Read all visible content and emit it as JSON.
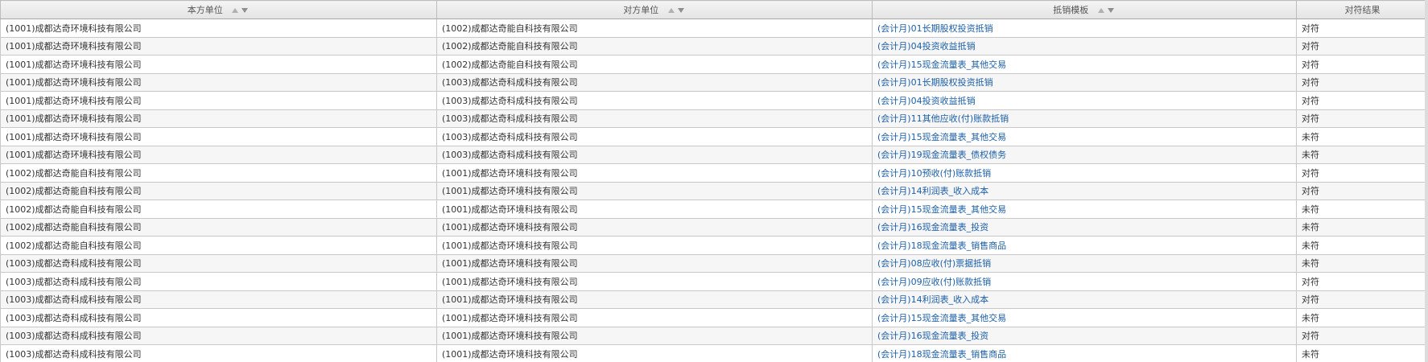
{
  "columns": [
    {
      "label": "本方单位",
      "sortable": true
    },
    {
      "label": "对方单位",
      "sortable": true
    },
    {
      "label": "抵销模板",
      "sortable": true
    },
    {
      "label": "对符结果",
      "sortable": false
    }
  ],
  "colors": {
    "link": "#1c5fa8",
    "header_bg": "#e9e9e9",
    "row_alt_bg": "#f6f6f6",
    "border": "#c8c8c8"
  },
  "rows": [
    {
      "own": "(1001)成都达奇环境科技有限公司",
      "counter": "(1002)成都达奇能自科技有限公司",
      "template": "(会计月)01长期股权投资抵销",
      "result": "对符"
    },
    {
      "own": "(1001)成都达奇环境科技有限公司",
      "counter": "(1002)成都达奇能自科技有限公司",
      "template": "(会计月)04投资收益抵销",
      "result": "对符"
    },
    {
      "own": "(1001)成都达奇环境科技有限公司",
      "counter": "(1002)成都达奇能自科技有限公司",
      "template": "(会计月)15现金流量表_其他交易",
      "result": "对符"
    },
    {
      "own": "(1001)成都达奇环境科技有限公司",
      "counter": "(1003)成都达奇科成科技有限公司",
      "template": "(会计月)01长期股权投资抵销",
      "result": "对符"
    },
    {
      "own": "(1001)成都达奇环境科技有限公司",
      "counter": "(1003)成都达奇科成科技有限公司",
      "template": "(会计月)04投资收益抵销",
      "result": "对符"
    },
    {
      "own": "(1001)成都达奇环境科技有限公司",
      "counter": "(1003)成都达奇科成科技有限公司",
      "template": "(会计月)11其他应收(付)账款抵销",
      "result": "对符"
    },
    {
      "own": "(1001)成都达奇环境科技有限公司",
      "counter": "(1003)成都达奇科成科技有限公司",
      "template": "(会计月)15现金流量表_其他交易",
      "result": "未符"
    },
    {
      "own": "(1001)成都达奇环境科技有限公司",
      "counter": "(1003)成都达奇科成科技有限公司",
      "template": "(会计月)19现金流量表_债权债务",
      "result": "未符"
    },
    {
      "own": "(1002)成都达奇能自科技有限公司",
      "counter": "(1001)成都达奇环境科技有限公司",
      "template": "(会计月)10预收(付)账款抵销",
      "result": "对符"
    },
    {
      "own": "(1002)成都达奇能自科技有限公司",
      "counter": "(1001)成都达奇环境科技有限公司",
      "template": "(会计月)14利润表_收入成本",
      "result": "对符"
    },
    {
      "own": "(1002)成都达奇能自科技有限公司",
      "counter": "(1001)成都达奇环境科技有限公司",
      "template": "(会计月)15现金流量表_其他交易",
      "result": "未符"
    },
    {
      "own": "(1002)成都达奇能自科技有限公司",
      "counter": "(1001)成都达奇环境科技有限公司",
      "template": "(会计月)16现金流量表_投资",
      "result": "未符"
    },
    {
      "own": "(1002)成都达奇能自科技有限公司",
      "counter": "(1001)成都达奇环境科技有限公司",
      "template": "(会计月)18现金流量表_销售商品",
      "result": "未符"
    },
    {
      "own": "(1003)成都达奇科成科技有限公司",
      "counter": "(1001)成都达奇环境科技有限公司",
      "template": "(会计月)08应收(付)票据抵销",
      "result": "未符"
    },
    {
      "own": "(1003)成都达奇科成科技有限公司",
      "counter": "(1001)成都达奇环境科技有限公司",
      "template": "(会计月)09应收(付)账款抵销",
      "result": "对符"
    },
    {
      "own": "(1003)成都达奇科成科技有限公司",
      "counter": "(1001)成都达奇环境科技有限公司",
      "template": "(会计月)14利润表_收入成本",
      "result": "对符"
    },
    {
      "own": "(1003)成都达奇科成科技有限公司",
      "counter": "(1001)成都达奇环境科技有限公司",
      "template": "(会计月)15现金流量表_其他交易",
      "result": "未符"
    },
    {
      "own": "(1003)成都达奇科成科技有限公司",
      "counter": "(1001)成都达奇环境科技有限公司",
      "template": "(会计月)16现金流量表_投资",
      "result": "对符"
    },
    {
      "own": "(1003)成都达奇科成科技有限公司",
      "counter": "(1001)成都达奇环境科技有限公司",
      "template": "(会计月)18现金流量表_销售商品",
      "result": "未符"
    }
  ]
}
